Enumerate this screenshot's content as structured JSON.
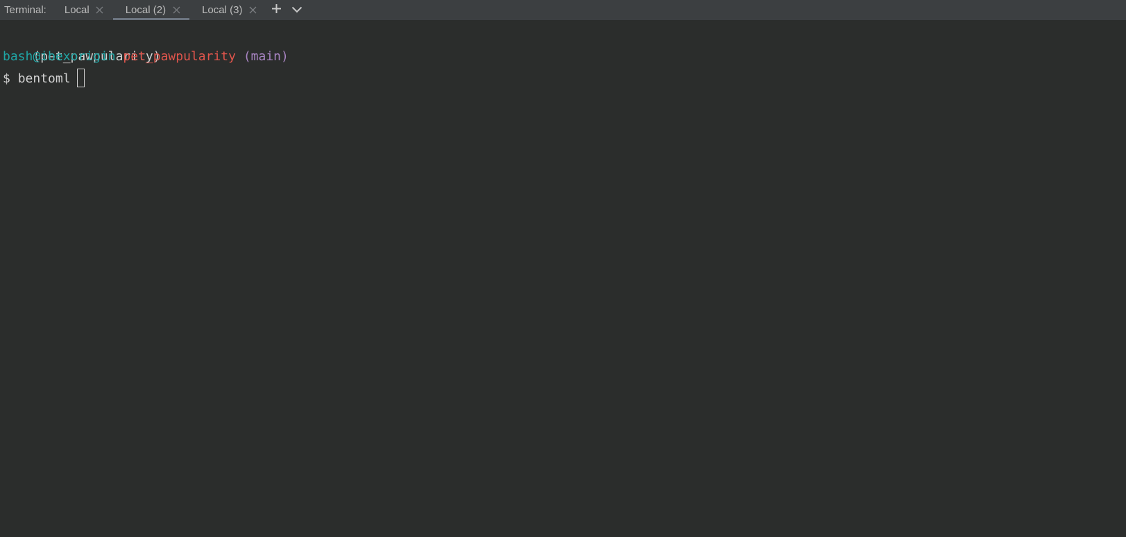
{
  "tabbar": {
    "title": "Terminal:",
    "tabs": [
      {
        "label": "Local"
      },
      {
        "label": "Local (2)"
      },
      {
        "label": "Local (3)"
      }
    ],
    "active_tab_index": 1,
    "new_tab_icon": "plus-icon",
    "dropdown_icon": "chevron-down-icon"
  },
  "terminal": {
    "venv": "(pet_pawpularity)",
    "prompt": {
      "user_host": "bash@ibexorigin",
      "directory": "pet_pawpularity",
      "branch": "(main)",
      "symbol": "$",
      "command": "bentoml"
    }
  },
  "colors": {
    "background": "#2b2d2c",
    "tabbar": "#3c3f41",
    "user_host": "#1fa5a5",
    "directory": "#e0554c",
    "branch": "#a884c2",
    "text": "#d2d2d2"
  }
}
